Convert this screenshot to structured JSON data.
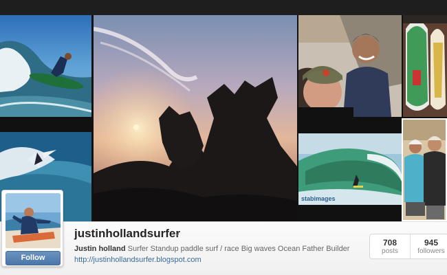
{
  "profile": {
    "username": "justinhollandsurfer",
    "bio_name": "Justin holland",
    "bio_text": "Surfer Standup paddle surf / race Big waves Ocean Father Builder",
    "website": "http://justinhollandsurfer.blogspot.com",
    "follow_label": "Follow"
  },
  "stats": {
    "posts_count": "708",
    "posts_label": "posts",
    "followers_count": "945",
    "followers_label": "followers"
  },
  "collage": {
    "photo_watermark": "stabimages"
  },
  "icons": {
    "dropdown": "chevron-down-icon"
  },
  "colors": {
    "follow_button": "#4a77a8",
    "link": "#3a6a9a",
    "username": "#222222"
  }
}
